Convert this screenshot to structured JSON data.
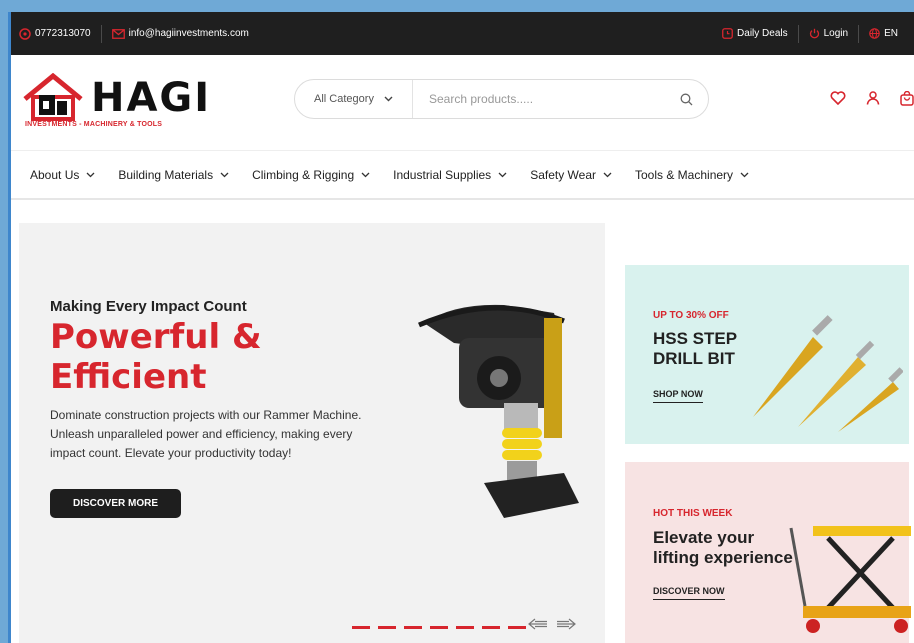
{
  "topbar": {
    "phone": "0772313070",
    "email": "info@hagiinvestments.com",
    "daily_deals": "Daily Deals",
    "login": "Login",
    "language": "EN"
  },
  "brand": {
    "name": "HAGI",
    "tagline": "INVESTMENTS - MACHINERY & TOOLS",
    "accent": "#d7262e"
  },
  "search": {
    "category": "All Category",
    "placeholder": "Search products....."
  },
  "header_icons": [
    "heart-icon",
    "user-icon",
    "bag-icon"
  ],
  "nav": {
    "items": [
      {
        "label": "About Us"
      },
      {
        "label": "Building Materials"
      },
      {
        "label": "Climbing & Rigging"
      },
      {
        "label": "Industrial Supplies"
      },
      {
        "label": "Safety Wear"
      },
      {
        "label": "Tools & Machinery"
      }
    ]
  },
  "hero": {
    "subtitle": "Making Every Impact Count",
    "title": "Powerful & Efficient",
    "description": "Dominate construction projects with our Rammer Machine. Unleash unparalleled power and efficiency, making every impact count. Elevate your productivity today!",
    "cta": "DISCOVER MORE",
    "slide_count": 7
  },
  "promos": [
    {
      "kicker": "UP TO 30% OFF",
      "title": "HSS STEP DRILL BIT",
      "link": "SHOP NOW"
    },
    {
      "kicker": "HOT THIS WEEK",
      "title": "Elevate your lifting experience",
      "link": "DISCOVER NOW"
    }
  ]
}
